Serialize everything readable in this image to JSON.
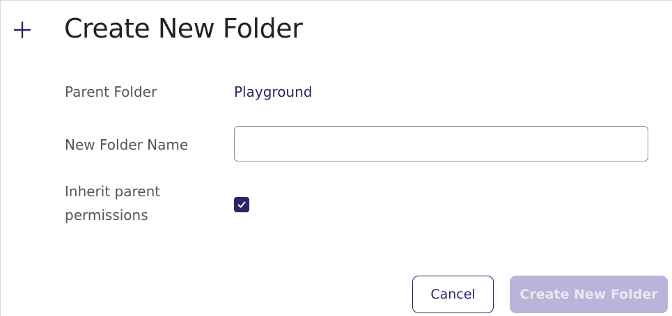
{
  "dialog": {
    "title": "Create New Folder",
    "icon": "plus-icon"
  },
  "form": {
    "parent_folder_label": "Parent Folder",
    "parent_folder_value": "Playground",
    "new_folder_name_label": "New Folder Name",
    "new_folder_name_value": "",
    "inherit_label_line1": "Inherit parent",
    "inherit_label_line2": "permissions",
    "inherit_checked": true
  },
  "actions": {
    "cancel_label": "Cancel",
    "create_label": "Create New Folder"
  },
  "colors": {
    "accent": "#2f2369",
    "disabled_button": "#b9b5d8"
  }
}
